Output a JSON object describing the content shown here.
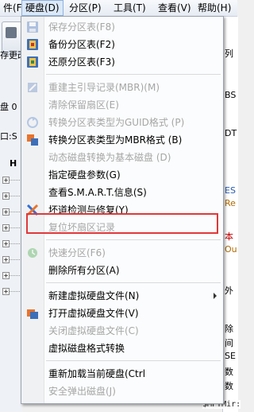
{
  "menubar": {
    "items": [
      {
        "label": "件(F)"
      },
      {
        "label": "硬盘(D)"
      },
      {
        "label": "分区(P)"
      },
      {
        "label": "工具(T)"
      },
      {
        "label": "查看(V)"
      },
      {
        "label": "帮助(H)"
      }
    ]
  },
  "leftpane": {
    "save_label": "存更改",
    "disk_label": "盘 0",
    "port_label": "口:S",
    "tree_head": "H"
  },
  "rightpane": {
    "texts": [
      "列",
      "BS",
      "DT",
      "ES",
      "Re",
      "本",
      "Ou",
      "外",
      "除",
      "间",
      "SE",
      "数",
      "数"
    ]
  },
  "bottom_text": "$MFTMir:",
  "menu": {
    "items": [
      {
        "label": "保存分区表(F8)",
        "icon": "save-icon",
        "disabled": true
      },
      {
        "label": "备份分区表(F2)",
        "icon": "backup-icon",
        "disabled": false
      },
      {
        "label": "还原分区表(F3)",
        "icon": "restore-icon",
        "disabled": false
      },
      {
        "label": "重建主引导记录(MBR)(M)",
        "icon": "rebuild-mbr-icon",
        "disabled": true
      },
      {
        "label": "清除保留扇区(E)",
        "icon": "",
        "disabled": true
      },
      {
        "label": "转换分区表类型为GUID格式 (P)",
        "icon": "convert-guid-icon",
        "disabled": true
      },
      {
        "label": "转换分区表类型为MBR格式 (B)",
        "icon": "convert-mbr-icon",
        "disabled": false
      },
      {
        "label": "动态磁盘转换为基本磁盘 (D)",
        "icon": "",
        "disabled": true
      },
      {
        "label": "指定硬盘参数(G)",
        "icon": "",
        "disabled": false
      },
      {
        "label": "查看S.M.A.R.T.信息(S)",
        "icon": "",
        "disabled": false
      },
      {
        "label": "坏道检测与修复(Y)",
        "icon": "bad-sector-repair-icon",
        "disabled": false
      },
      {
        "label": "复位坏扇区记录",
        "icon": "",
        "disabled": true
      },
      {
        "label": "快速分区(F6)",
        "icon": "quick-partition-icon",
        "disabled": true
      },
      {
        "label": "删除所有分区(A)",
        "icon": "",
        "disabled": false
      },
      {
        "label": "新建虚拟硬盘文件(N)",
        "icon": "",
        "disabled": false
      },
      {
        "label": "打开虚拟硬盘文件(V)",
        "icon": "open-virtual-disk-icon",
        "disabled": false
      },
      {
        "label": "关闭虚拟硬盘文件(C)",
        "icon": "",
        "disabled": true
      },
      {
        "label": "虚拟磁盘格式转换",
        "icon": "",
        "disabled": false
      },
      {
        "label": "重新加载当前硬盘(Ctrl",
        "icon": "",
        "disabled": false
      },
      {
        "label": "安全弹出磁盘(J)",
        "icon": "",
        "disabled": true
      }
    ]
  },
  "colors": {
    "highlight_box": "#e0383a"
  }
}
